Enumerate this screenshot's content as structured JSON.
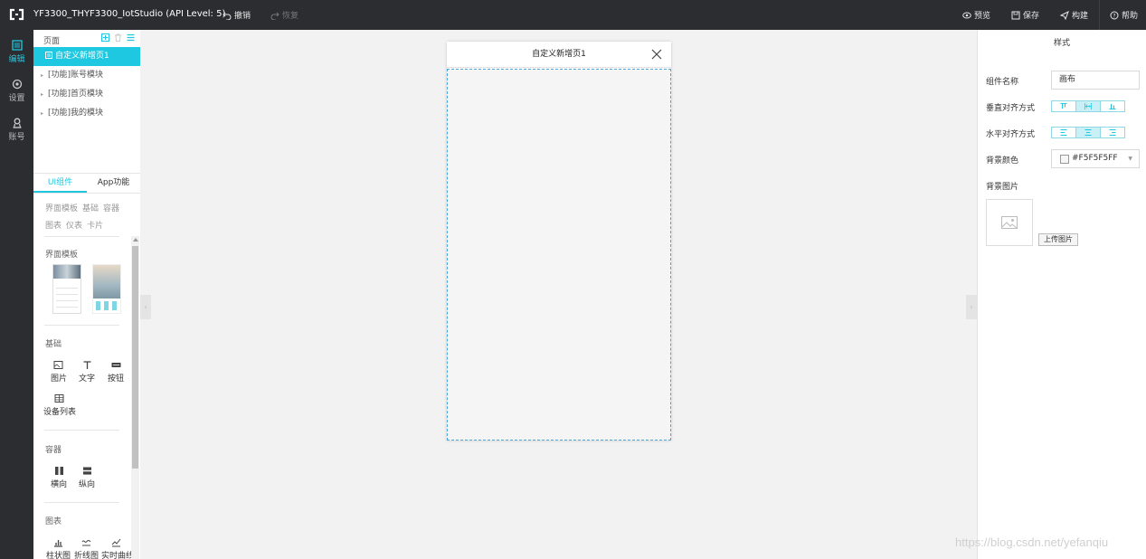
{
  "app": {
    "title": "YF3300_THYF3300_IotStudio (API Level: 5)",
    "undo": "撤销",
    "redo": "恢复",
    "preview": "预览",
    "save": "保存",
    "build": "构建",
    "help": "帮助"
  },
  "rail": [
    {
      "label": "编辑",
      "icon": "edit-icon",
      "active": true
    },
    {
      "label": "设置",
      "icon": "settings-icon",
      "active": false
    },
    {
      "label": "账号",
      "icon": "account-icon",
      "active": false
    }
  ],
  "pages": {
    "header": "页面",
    "items": [
      "自定义新增页1",
      "[功能]账号模块",
      "[功能]首页模块",
      "[功能]我的模块"
    ]
  },
  "components": {
    "tabs": [
      "UI组件",
      "App功能"
    ],
    "filters": [
      "界面模板",
      "基础",
      "容器",
      "图表",
      "仪表",
      "卡片"
    ],
    "sections": {
      "template": "界面模板",
      "basic": "基础",
      "container": "容器",
      "chart": "图表"
    },
    "basic_items": [
      "图片",
      "文字",
      "按钮",
      "设备列表"
    ],
    "container_items": [
      "横向",
      "纵向"
    ],
    "chart_items": [
      "柱状图",
      "折线图",
      "实时曲线"
    ]
  },
  "phone": {
    "title": "自定义新增页1"
  },
  "style_panel": {
    "title": "样式",
    "component_name_label": "组件名称",
    "component_name_value": "画布",
    "vertical_align_label": "垂直对齐方式",
    "horizontal_align_label": "水平对齐方式",
    "bg_color_label": "背景颜色",
    "bg_color_value": "#F5F5F5FF",
    "bg_image_label": "背景图片",
    "upload_label": "上传图片"
  },
  "colors": {
    "accent": "#1ec8e0",
    "topbar": "#2b2d31"
  },
  "watermark": "https://blog.csdn.net/yefanqiu"
}
